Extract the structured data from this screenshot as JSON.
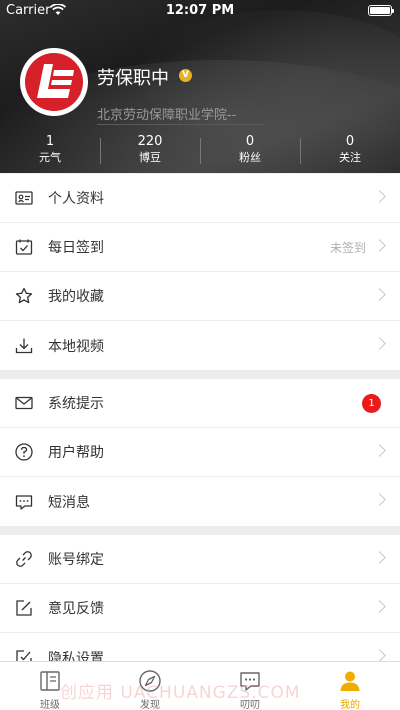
{
  "status_bar": {
    "carrier": "Carrier",
    "time": "12:07 PM"
  },
  "profile": {
    "name": "劳保职中",
    "verified_badge": "V",
    "school": "北京劳动保障职业学院--",
    "stats": [
      {
        "value": "1",
        "label": "元气"
      },
      {
        "value": "220",
        "label": "博豆"
      },
      {
        "value": "0",
        "label": "粉丝"
      },
      {
        "value": "0",
        "label": "关注"
      }
    ]
  },
  "menu": {
    "groups": [
      {
        "items": [
          {
            "label": "个人资料",
            "icon": "id-card-icon"
          },
          {
            "label": "每日签到",
            "icon": "calendar-check-icon",
            "status": "未签到"
          },
          {
            "label": "我的收藏",
            "icon": "star-icon"
          },
          {
            "label": "本地视频",
            "icon": "download-icon"
          }
        ]
      },
      {
        "items": [
          {
            "label": "系统提示",
            "icon": "envelope-icon",
            "badge": "1"
          },
          {
            "label": "用户帮助",
            "icon": "question-icon"
          },
          {
            "label": "短消息",
            "icon": "message-icon"
          }
        ]
      },
      {
        "items": [
          {
            "label": "账号绑定",
            "icon": "link-icon"
          },
          {
            "label": "意见反馈",
            "icon": "edit-icon"
          },
          {
            "label": "隐私设置",
            "icon": "checklist-icon"
          }
        ]
      }
    ]
  },
  "tabbar": {
    "tabs": [
      {
        "label": "班级",
        "icon": "class-book-icon"
      },
      {
        "label": "发现",
        "icon": "compass-icon"
      },
      {
        "label": "叨叨",
        "icon": "chat-icon"
      },
      {
        "label": "我的",
        "icon": "person-icon",
        "active": true
      }
    ]
  },
  "watermark": "创应用 UACHUANGZS.COM",
  "colors": {
    "accent": "#e5a700",
    "badge": "#ea1b1b",
    "logo_red": "#d6202a"
  }
}
